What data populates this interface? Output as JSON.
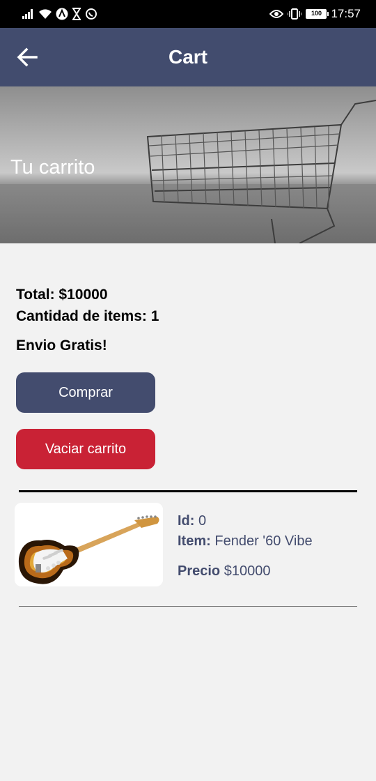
{
  "status_bar": {
    "time": "17:57",
    "battery": "100",
    "icons": [
      "signal-icon",
      "wifi-icon",
      "app-a-icon",
      "hourglass-icon",
      "whatsapp-icon",
      "eye-icon",
      "vibrate-icon",
      "battery-icon"
    ]
  },
  "app_bar": {
    "title": "Cart",
    "back_icon": "arrow-left-icon",
    "background": "#424c6e"
  },
  "hero": {
    "title": "Tu carrito"
  },
  "summary": {
    "total": "Total: $10000",
    "count": "Cantidad de items: 1",
    "shipping": "Envio Gratis!"
  },
  "buttons": {
    "buy": "Comprar",
    "empty": "Vaciar carrito"
  },
  "colors": {
    "primary": "#434c6e",
    "danger": "#c92235",
    "background": "#f2f2f2"
  },
  "cart_items": [
    {
      "id_label": "Id:",
      "id": "0",
      "item_label": "Item:",
      "item": "Fender '60 Vibe",
      "price_label": "Precio",
      "price": "$10000",
      "image": "electric-guitar-image"
    }
  ]
}
